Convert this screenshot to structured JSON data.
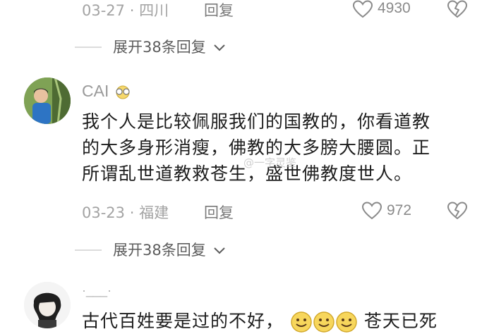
{
  "comments": [
    {
      "date": "03-27",
      "sep": "·",
      "location": "四川",
      "reply_label": "回复",
      "likes": "4930",
      "expand_label": "展开38条回复"
    },
    {
      "username": "CAI",
      "text_lines": [
        "我个人是比较佩服我们的国教的，你看道教",
        "的大多身形消瘦，佛教的大多膀大腰圆。正",
        "所谓乱世道教救苍生，盛世佛教度世人。"
      ],
      "date": "03-23",
      "sep": "·",
      "location": "福建",
      "reply_label": "回复",
      "likes": "972",
      "expand_label": "展开38条回复"
    },
    {
      "username": "·___·",
      "text_start": "古代百姓要是过的不好，",
      "text_end": "苍天已死"
    }
  ],
  "watermark": "@一字灵鉴",
  "colors": {
    "meta": "#a3a3a3",
    "text": "#1d1d1d",
    "line": "#dcdcdc"
  },
  "icons": [
    "heart-outline-icon",
    "broken-heart-icon",
    "chevron-down-icon",
    "emoji-smile-icon"
  ]
}
